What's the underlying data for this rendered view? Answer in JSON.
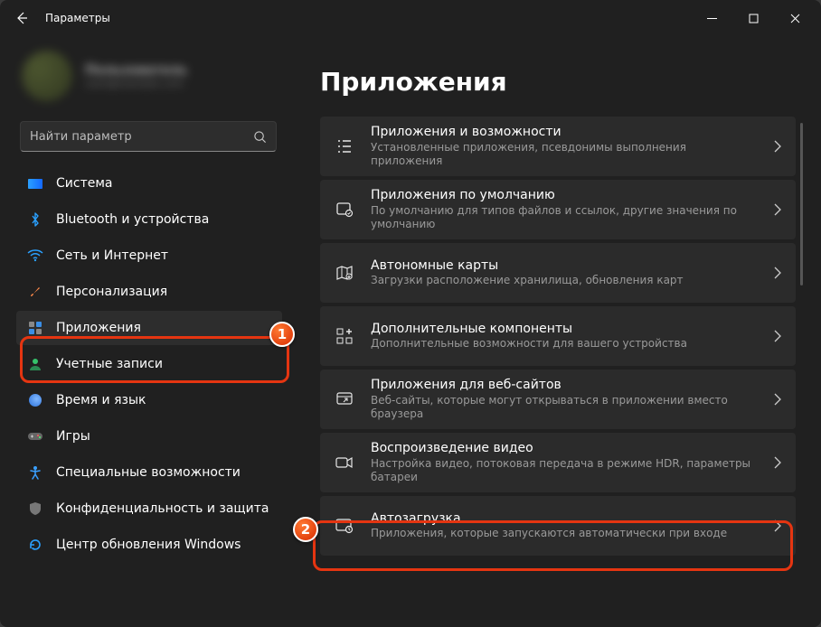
{
  "window": {
    "title": "Параметры"
  },
  "profile": {
    "name": "Пользователь",
    "email": "user@example.com"
  },
  "search": {
    "placeholder": "Найти параметр"
  },
  "sidebar": {
    "items": [
      {
        "label": "Система"
      },
      {
        "label": "Bluetooth и устройства"
      },
      {
        "label": "Сеть и Интернет"
      },
      {
        "label": "Персонализация"
      },
      {
        "label": "Приложения"
      },
      {
        "label": "Учетные записи"
      },
      {
        "label": "Время и язык"
      },
      {
        "label": "Игры"
      },
      {
        "label": "Специальные возможности"
      },
      {
        "label": "Конфиденциальность и защита"
      },
      {
        "label": "Центр обновления Windows"
      }
    ]
  },
  "page": {
    "title": "Приложения"
  },
  "cards": [
    {
      "title": "Приложения и возможности",
      "descr": "Установленные приложения, псевдонимы выполнения приложения"
    },
    {
      "title": "Приложения по умолчанию",
      "descr": "По умолчанию для типов файлов и ссылок, другие значения по умолчанию"
    },
    {
      "title": "Автономные карты",
      "descr": "Загрузки расположение хранилища, обновления карт"
    },
    {
      "title": "Дополнительные компоненты",
      "descr": "Дополнительные возможности для вашего устройства"
    },
    {
      "title": "Приложения для веб-сайтов",
      "descr": "Веб-сайты, которые могут открываться в приложении вместо браузера"
    },
    {
      "title": "Воспроизведение видео",
      "descr": "Настройка видео, потоковая передача в режиме HDR, параметры батареи"
    },
    {
      "title": "Автозагрузка",
      "descr": "Приложения, которые запускаются автоматически при входе"
    }
  ],
  "annotations": {
    "badge1": "1",
    "badge2": "2"
  }
}
